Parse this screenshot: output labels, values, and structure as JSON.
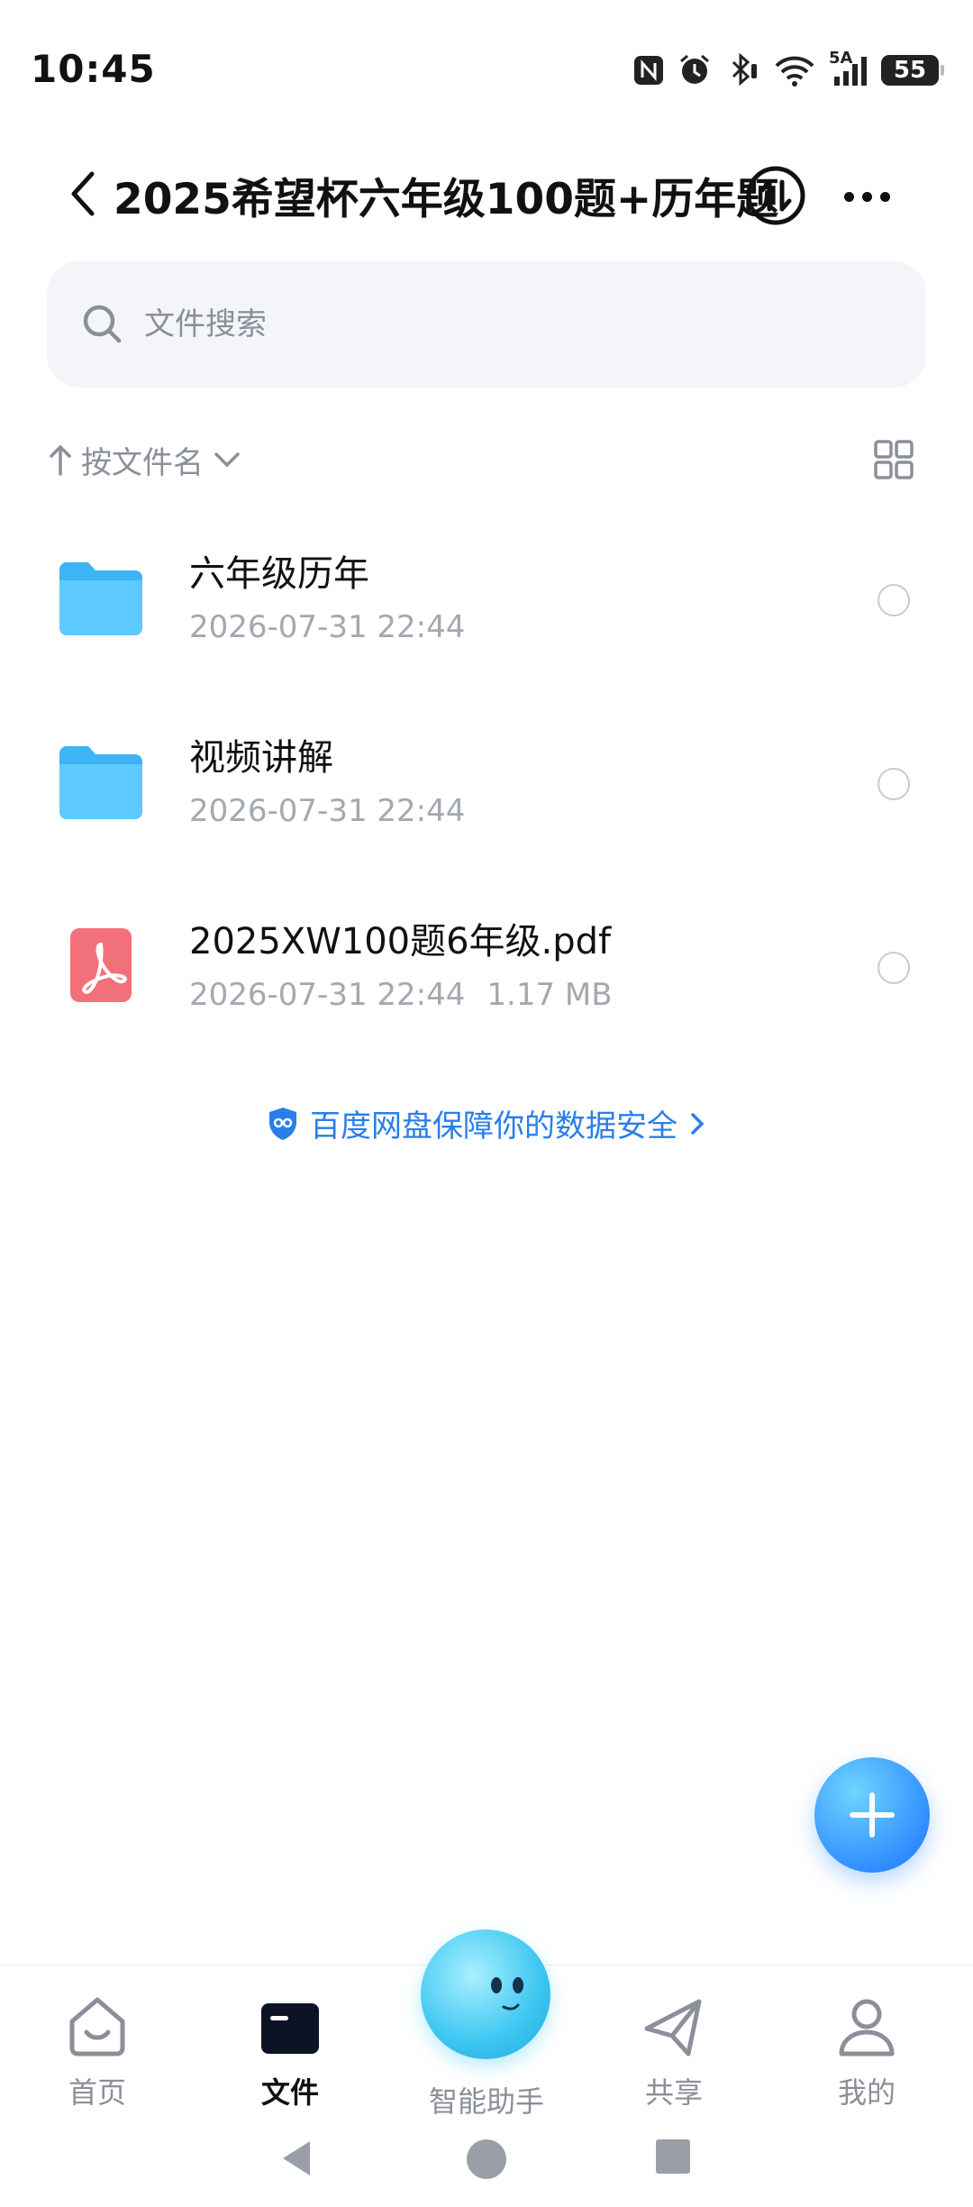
{
  "status_bar": {
    "time": "10:45",
    "network": "5A",
    "battery": "55",
    "icons": [
      "nfc-icon",
      "alarm-icon",
      "bluetooth-icon",
      "wifi-icon",
      "signal-icon",
      "battery-icon"
    ]
  },
  "header": {
    "title": "2025希望杯六年级100题+历年题"
  },
  "search": {
    "placeholder": "文件搜索"
  },
  "sort": {
    "label": "按文件名"
  },
  "files": [
    {
      "name": "六年级历年",
      "date": "2026-07-31 22:44",
      "size": "",
      "type": "folder"
    },
    {
      "name": "视频讲解",
      "date": "2026-07-31 22:44",
      "size": "",
      "type": "folder"
    },
    {
      "name": "2025XW100题6年级.pdf",
      "date": "2026-07-31 22:44",
      "size": "1.17 MB",
      "type": "pdf"
    }
  ],
  "safety_link": "百度网盘保障你的数据安全",
  "nav": {
    "home": "首页",
    "files": "文件",
    "assistant": "智能助手",
    "share": "共享",
    "mine": "我的"
  },
  "colors": {
    "accent": "#2b7de9",
    "folder": "#3cb4f5",
    "pdf": "#f2707a"
  }
}
